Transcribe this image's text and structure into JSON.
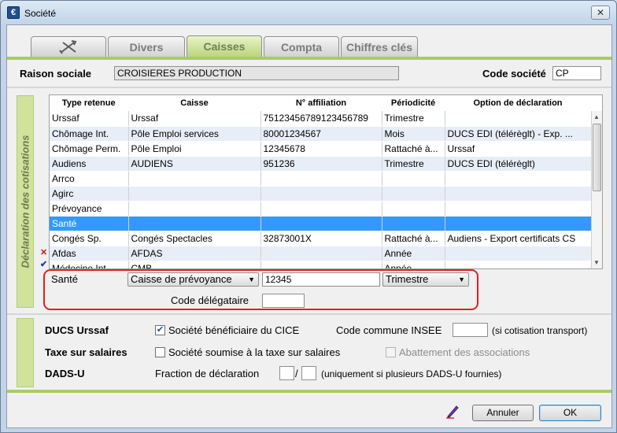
{
  "window": {
    "title": "Société",
    "app_icon": "€",
    "close_glyph": "✕"
  },
  "tabs": [
    {
      "label": "",
      "icon": "tools-icon"
    },
    {
      "label": "Divers"
    },
    {
      "label": "Caisses",
      "active": true
    },
    {
      "label": "Compta"
    },
    {
      "label": "Chiffres clés"
    }
  ],
  "header": {
    "raison_label": "Raison sociale",
    "raison_value": "CROISIERES PRODUCTION",
    "code_label": "Code société",
    "code_value": "CP"
  },
  "cotisations": {
    "section_label": "Déclaration des cotisations",
    "columns": [
      "Type retenue",
      "Caisse",
      "N° affiliation",
      "Périodicité",
      "Option de déclaration"
    ],
    "rows": [
      [
        "Urssaf",
        "Urssaf",
        "75123456789123456789",
        "Trimestre",
        ""
      ],
      [
        "Chômage Int.",
        "Pôle Emploi services",
        "80001234567",
        "Mois",
        "DUCS EDI (télérèglt) - Exp. ..."
      ],
      [
        "Chômage Perm.",
        "Pôle Emploi",
        "12345678",
        "Rattaché à...",
        "Urssaf"
      ],
      [
        "Audiens",
        "AUDIENS",
        "951236",
        "Trimestre",
        "DUCS EDI (télérèglt)"
      ],
      [
        "Arrco",
        "",
        "",
        "",
        ""
      ],
      [
        "Agirc",
        "",
        "",
        "",
        ""
      ],
      [
        "Prévoyance",
        "",
        "",
        "",
        ""
      ],
      [
        "Santé",
        "",
        "",
        "",
        ""
      ],
      [
        "Congés Sp.",
        "Congés Spectacles",
        "32873001X",
        "Rattaché à...",
        "Audiens - Export certificats CS"
      ],
      [
        "Afdas",
        "AFDAS",
        "",
        "Année",
        ""
      ],
      [
        "Médecine Int.",
        "CMB",
        "",
        "Année",
        ""
      ]
    ],
    "selected_row": 7,
    "marks": {
      "afdas": "✕",
      "medecine": "✔"
    },
    "edit": {
      "type": "Santé",
      "caisse": "Caisse de prévoyance",
      "affiliation": "12345",
      "periodicite": "Trimestre",
      "code_delegataire_label": "Code délégataire",
      "code_delegataire_value": ""
    }
  },
  "options": {
    "ducs_label": "DUCS Urssaf",
    "cice_label": "Société bénéficiaire du CICE",
    "cice_checked": true,
    "insee_label": "Code commune INSEE",
    "insee_value": "",
    "insee_hint": "(si cotisation transport)",
    "taxe_label": "Taxe sur salaires",
    "taxe_cb_label": "Société soumise à la taxe sur salaires",
    "taxe_checked": false,
    "abattement_label": "Abattement des associations",
    "abattement_checked": false,
    "dadsu_label": "DADS-U",
    "fraction_label": "Fraction de déclaration",
    "fraction_num": "",
    "fraction_sep": "/",
    "fraction_den": "",
    "fraction_hint": "(uniquement si plusieurs DADS-U fournies)"
  },
  "footer": {
    "annuler_label": "Annuler",
    "ok_label": "OK"
  }
}
